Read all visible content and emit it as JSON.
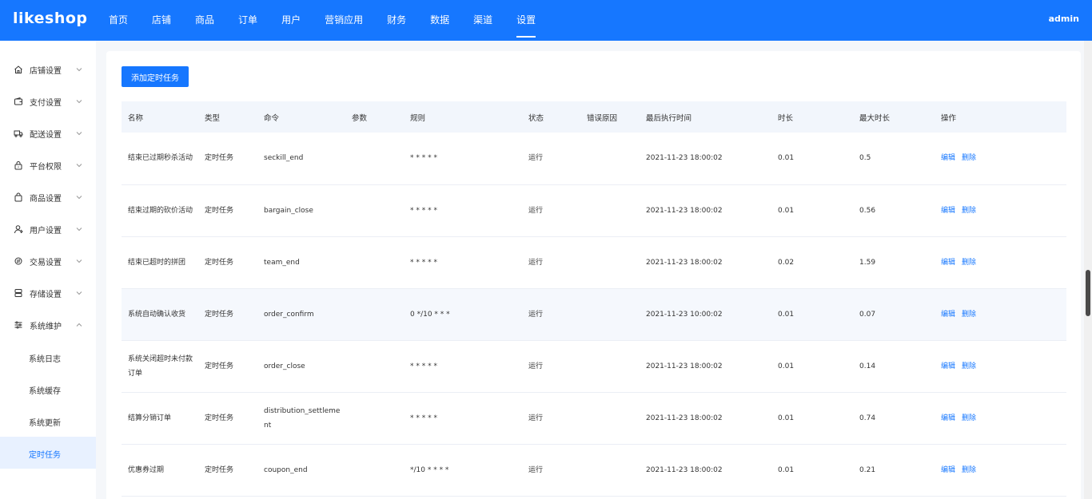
{
  "brand": "likeshop",
  "user": "admin",
  "nav": [
    "首页",
    "店铺",
    "商品",
    "订单",
    "用户",
    "营销应用",
    "财务",
    "数据",
    "渠道",
    "设置"
  ],
  "nav_active": 9,
  "sidebar": {
    "groups": [
      {
        "label": "店铺设置",
        "icon": "home-icon"
      },
      {
        "label": "支付设置",
        "icon": "wallet-icon"
      },
      {
        "label": "配送设置",
        "icon": "truck-icon"
      },
      {
        "label": "平台权限",
        "icon": "lock-icon"
      },
      {
        "label": "商品设置",
        "icon": "bag-icon"
      },
      {
        "label": "用户设置",
        "icon": "user-icon"
      },
      {
        "label": "交易设置",
        "icon": "exchange-icon"
      },
      {
        "label": "存储设置",
        "icon": "storage-icon"
      },
      {
        "label": "系统维护",
        "icon": "sliders-icon"
      }
    ],
    "sub_items": [
      "系统日志",
      "系统缓存",
      "系统更新",
      "定时任务"
    ],
    "sub_active": 3
  },
  "main": {
    "add_button": "添加定时任务",
    "table": {
      "columns": [
        "名称",
        "类型",
        "命令",
        "参数",
        "规则",
        "状态",
        "错误原因",
        "最后执行时间",
        "时长",
        "最大时长",
        "操作"
      ],
      "rows": [
        {
          "name": "结束已过期秒杀活动",
          "type": "定时任务",
          "command": "seckill_end",
          "params": "",
          "rule": "* * * * *",
          "status": "运行",
          "error": "",
          "last_run": "2021-11-23 18:00:02",
          "duration": "0.01",
          "max_duration": "0.5"
        },
        {
          "name": "结束过期的砍价活动",
          "type": "定时任务",
          "command": "bargain_close",
          "params": "",
          "rule": "* * * * *",
          "status": "运行",
          "error": "",
          "last_run": "2021-11-23 18:00:02",
          "duration": "0.01",
          "max_duration": "0.56"
        },
        {
          "name": "结束已超时的拼团",
          "type": "定时任务",
          "command": "team_end",
          "params": "",
          "rule": "* * * * *",
          "status": "运行",
          "error": "",
          "last_run": "2021-11-23 18:00:02",
          "duration": "0.02",
          "max_duration": "1.59"
        },
        {
          "name": "系统自动确认收货",
          "type": "定时任务",
          "command": "order_confirm",
          "params": "",
          "rule": "0 */10 * * *",
          "status": "运行",
          "error": "",
          "last_run": "2021-11-23 10:00:02",
          "duration": "0.01",
          "max_duration": "0.07"
        },
        {
          "name": "系统关闭超时未付款订单",
          "type": "定时任务",
          "command": "order_close",
          "params": "",
          "rule": "* * * * *",
          "status": "运行",
          "error": "",
          "last_run": "2021-11-23 18:00:02",
          "duration": "0.01",
          "max_duration": "0.14"
        },
        {
          "name": "结算分销订单",
          "type": "定时任务",
          "command": "distribution_settlement",
          "params": "",
          "rule": "* * * * *",
          "status": "运行",
          "error": "",
          "last_run": "2021-11-23 18:00:02",
          "duration": "0.01",
          "max_duration": "0.74"
        },
        {
          "name": "优惠券过期",
          "type": "定时任务",
          "command": "coupon_end",
          "params": "",
          "rule": "*/10 * * * *",
          "status": "运行",
          "error": "",
          "last_run": "2021-11-23 18:00:02",
          "duration": "0.01",
          "max_duration": "0.21"
        }
      ],
      "highlight_row": 3,
      "actions": {
        "edit": "编辑",
        "delete": "删除"
      }
    }
  },
  "colors": {
    "primary": "#1677ff",
    "header_bg": "#f2f6fc",
    "row_highlight": "#f5f8fd"
  }
}
